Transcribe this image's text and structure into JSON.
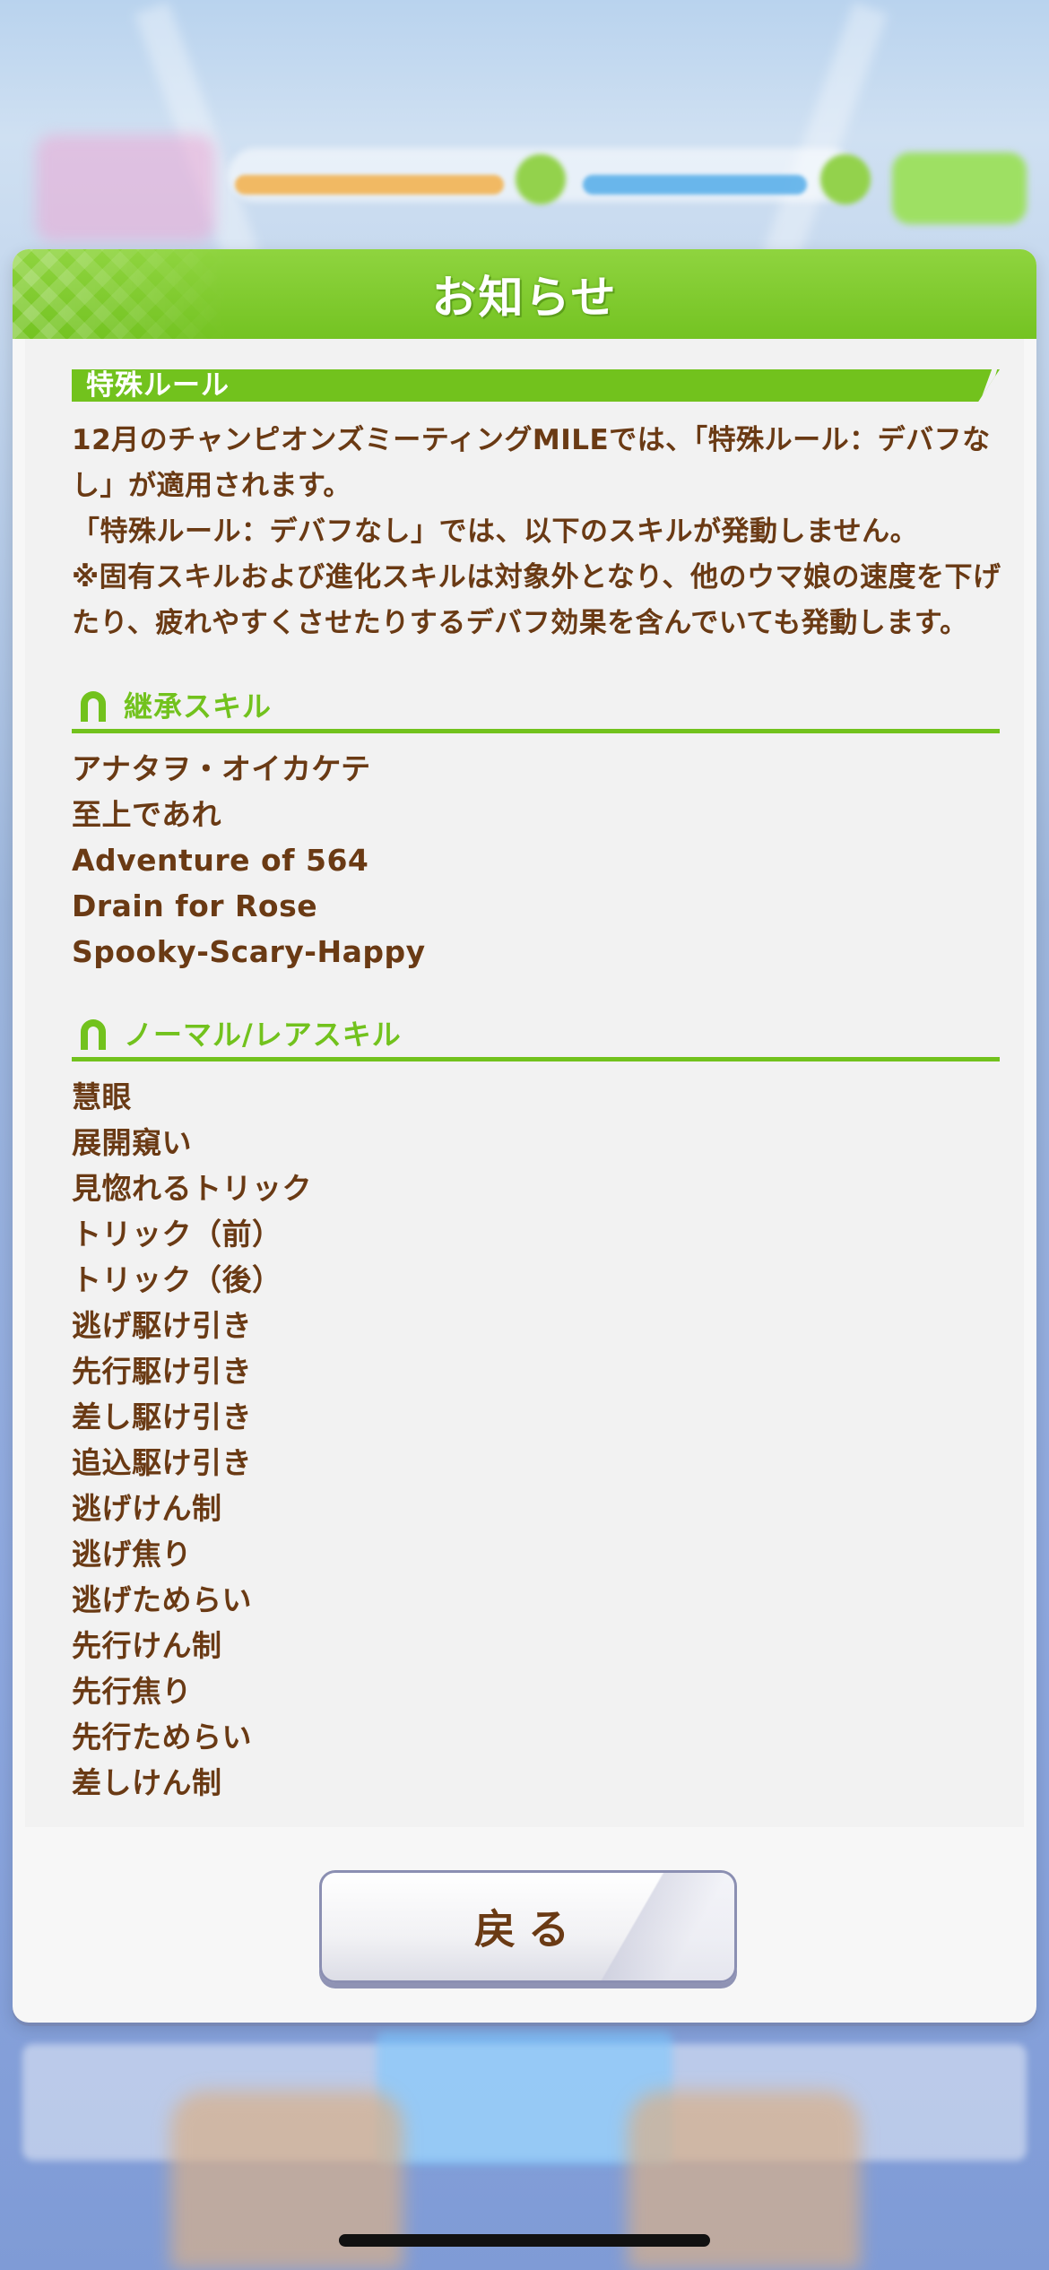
{
  "dialog": {
    "title": "お知らせ",
    "rule_banner": "特殊ルール",
    "paragraphs": [
      "12月のチャンピオンズミーティングMILEでは、「特殊ルール：デバフなし」が適用されます。",
      "「特殊ルール：デバフなし」では、以下のスキルが発動しません。",
      "※固有スキルおよび進化スキルは対象外となり、他のウマ娘の速度を下げたり、疲れやすくさせたりするデバフ効果を含んでいても発動します。"
    ],
    "sections": [
      {
        "label": "継承スキル",
        "icon": "horseshoe-icon",
        "skills": [
          "アナタヲ・オイカケテ",
          "至上であれ",
          "Adventure of 564",
          "Drain for Rose",
          "Spooky-Scary-Happy"
        ]
      },
      {
        "label": "ノーマル/レアスキル",
        "icon": "horseshoe-icon",
        "skills": [
          "慧眼",
          "展開窺い",
          "見惚れるトリック",
          "トリック（前）",
          "トリック（後）",
          "逃げ駆け引き",
          "先行駆け引き",
          "差し駆け引き",
          "追込駆け引き",
          "逃げけん制",
          "逃げ焦り",
          "逃げためらい",
          "先行けん制",
          "先行焦り",
          "先行ためらい",
          "差しけん制"
        ]
      }
    ],
    "back_button": "戻る"
  },
  "colors": {
    "header_green": "#74c322",
    "text_brown": "#6a3a14",
    "section_green": "#72c21d"
  }
}
